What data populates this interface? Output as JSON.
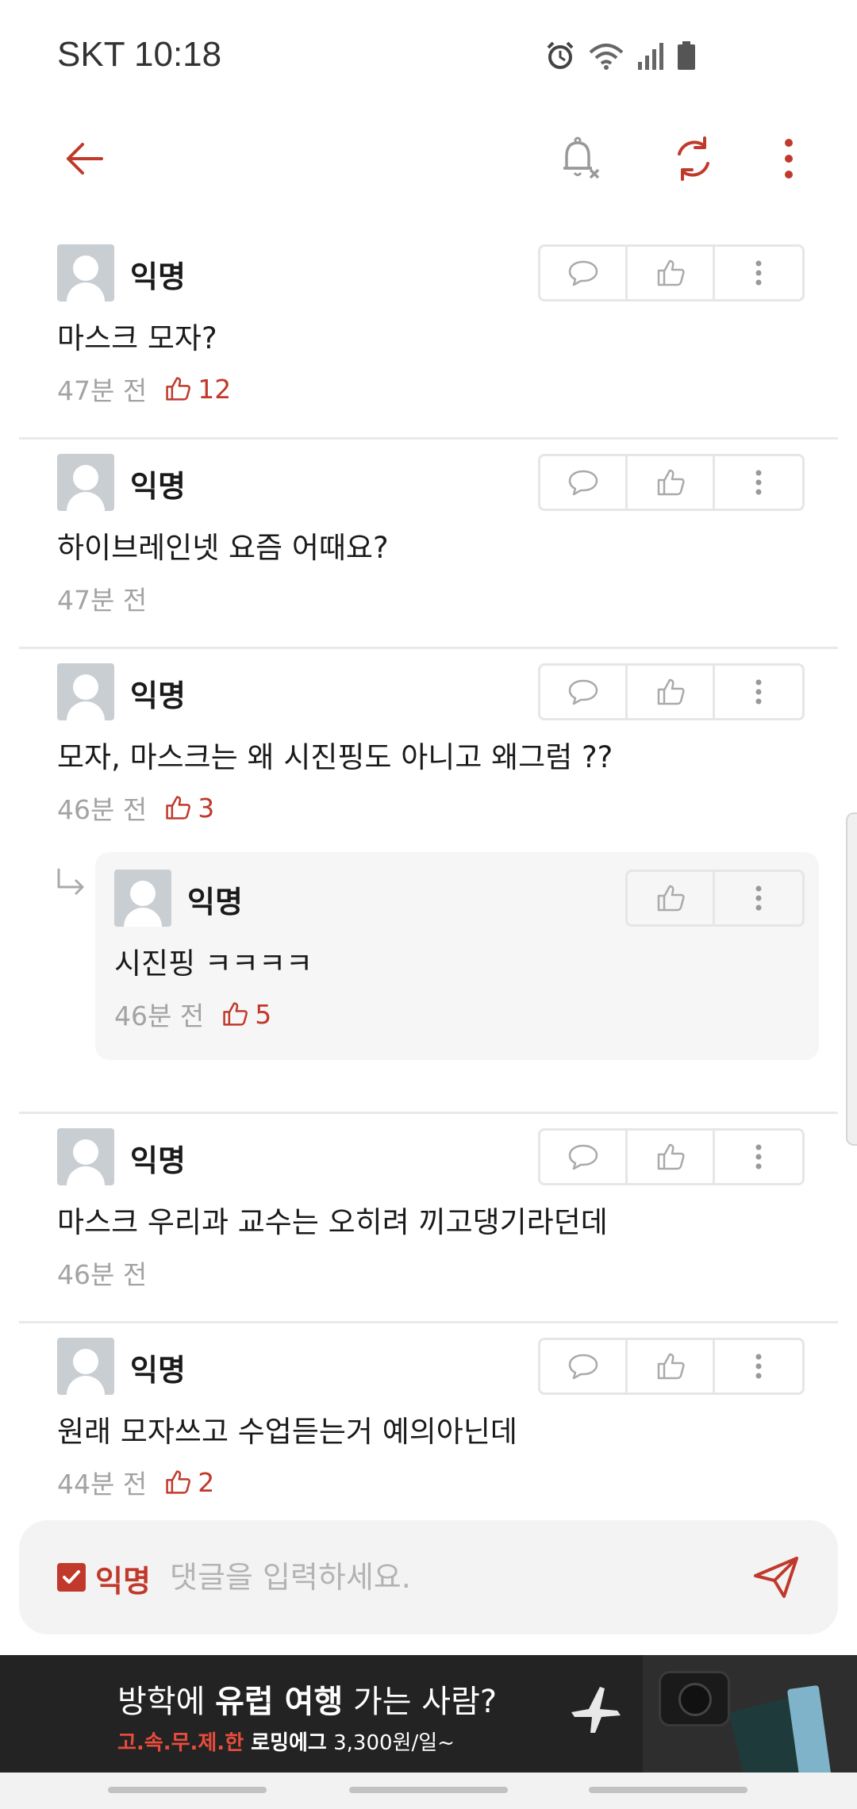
{
  "status_bar": {
    "carrier_time": "SKT 10:18",
    "icons": [
      "alarm-icon",
      "wifi-icon",
      "signal-icon",
      "battery-icon"
    ]
  },
  "header": {
    "icons": [
      "back-arrow-icon",
      "notification-off-icon",
      "refresh-icon",
      "more-vertical-icon"
    ]
  },
  "comments": [
    {
      "nickname": "익명",
      "text": "마스크 모자?",
      "time": "47분 전",
      "likes": "12",
      "actions": [
        "comment-icon",
        "thumbs-up-icon",
        "more-vertical-icon"
      ]
    },
    {
      "nickname": "익명",
      "text": "하이브레인넷 요즘 어때요?",
      "time": "47분 전",
      "likes": "",
      "actions": [
        "comment-icon",
        "thumbs-up-icon",
        "more-vertical-icon"
      ]
    },
    {
      "nickname": "익명",
      "text": "모자, 마스크는 왜 시진핑도 아니고 왜그럼 ??",
      "time": "46분 전",
      "likes": "3",
      "actions": [
        "comment-icon",
        "thumbs-up-icon",
        "more-vertical-icon"
      ]
    },
    {
      "nickname": "익명",
      "text": "마스크 우리과 교수는 오히려 끼고댕기라던데",
      "time": "46분 전",
      "likes": "",
      "actions": [
        "comment-icon",
        "thumbs-up-icon",
        "more-vertical-icon"
      ]
    },
    {
      "nickname": "익명",
      "text": "원래 모자쓰고 수업듣는거 예의아닌데",
      "time": "44분 전",
      "likes": "2",
      "actions": [
        "comment-icon",
        "thumbs-up-icon",
        "more-vertical-icon"
      ]
    }
  ],
  "reply": {
    "nickname": "익명",
    "text": "시진핑 ㅋㅋㅋㅋ",
    "time": "46분 전",
    "likes": "5",
    "actions": [
      "thumbs-up-icon",
      "more-vertical-icon"
    ]
  },
  "composer": {
    "anonymous_label": "익명",
    "anonymous_checked": true,
    "placeholder": "댓글을 입력하세요.",
    "value": ""
  },
  "ad": {
    "headline_pre": "방학에 ",
    "headline_accent": "유럽 여행",
    "headline_post": " 가는 사람?",
    "sub_red": "고.속.무.제.한",
    "sub_bold": " 로밍에그",
    "sub_rest": " 3,300원/일~"
  },
  "colors": {
    "accent": "#c0392b",
    "meta_gray": "#a3a3a3",
    "divider": "#e9e9e9",
    "reply_bg": "#f6f6f6",
    "composer_bg": "#f3f3f3",
    "ad_bg": "#232323"
  }
}
